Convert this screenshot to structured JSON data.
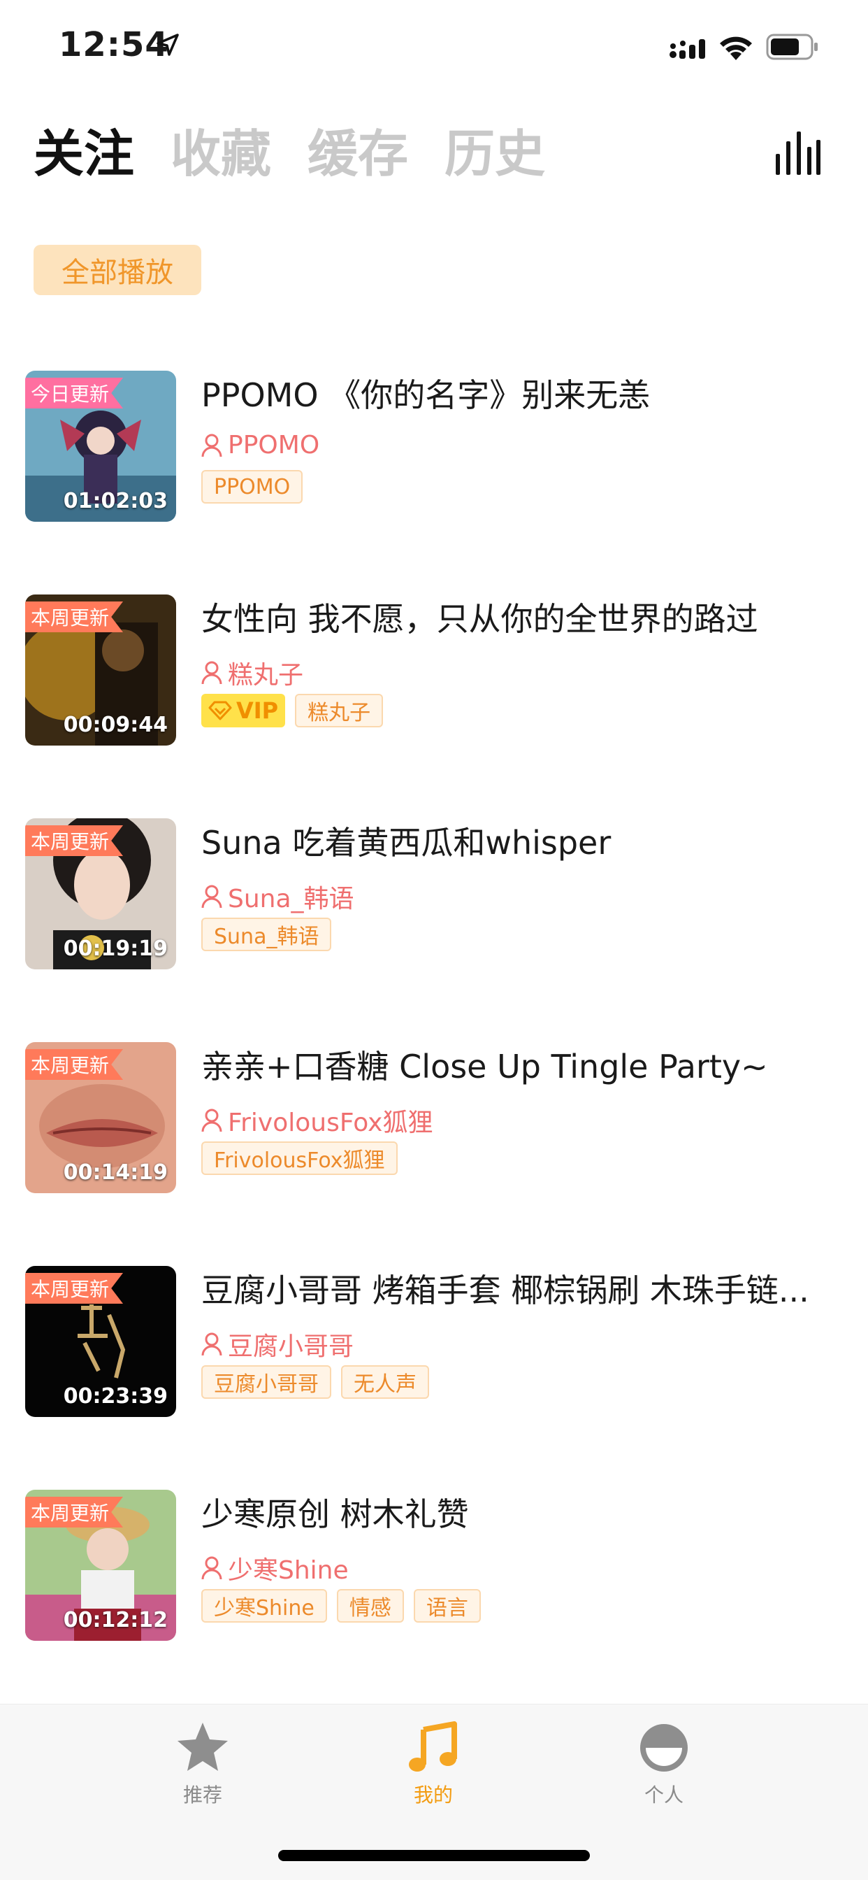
{
  "status_bar": {
    "time": "12:54"
  },
  "header": {
    "tabs": [
      {
        "label": "关注",
        "active": true
      },
      {
        "label": "收藏",
        "active": false
      },
      {
        "label": "缓存",
        "active": false
      },
      {
        "label": "历史",
        "active": false
      }
    ],
    "icon": "equalizer-icon"
  },
  "play_all_label": "全部播放",
  "items": [
    {
      "badge": "今日更新",
      "duration": "01:02:03",
      "title": "PPOMO 《你的名字》别来无恙",
      "author": "PPOMO",
      "tags": [
        "PPOMO"
      ],
      "vip": false
    },
    {
      "badge": "本周更新",
      "duration": "00:09:44",
      "title": "女性向 我不愿，只从你的全世界的路过",
      "author": "糕丸子",
      "tags": [
        "糕丸子"
      ],
      "vip": true,
      "vip_label": "VIP"
    },
    {
      "badge": "本周更新",
      "duration": "00:19:19",
      "title": "Suna 吃着黄西瓜和whisper",
      "author": "Suna_韩语",
      "tags": [
        "Suna_韩语"
      ],
      "vip": false
    },
    {
      "badge": "本周更新",
      "duration": "00:14:19",
      "title": "亲亲+口香糖 Close Up Tingle Party~",
      "author": "FrivolousFox狐狸",
      "tags": [
        "FrivolousFox狐狸"
      ],
      "vip": false
    },
    {
      "badge": "本周更新",
      "duration": "00:23:39",
      "title": "豆腐小哥哥 烤箱手套 椰棕锅刷 木珠手链...",
      "author": "豆腐小哥哥",
      "tags": [
        "豆腐小哥哥",
        "无人声"
      ],
      "vip": false
    },
    {
      "badge": "本周更新",
      "duration": "00:12:12",
      "title": "少寒原创 树木礼赞",
      "author": "少寒Shine",
      "tags": [
        "少寒Shine",
        "情感",
        "语言"
      ],
      "vip": false
    }
  ],
  "tabbar": {
    "items": [
      {
        "label": "推荐",
        "icon": "star-icon",
        "active": false
      },
      {
        "label": "我的",
        "icon": "music-note-icon",
        "active": true
      },
      {
        "label": "个人",
        "icon": "profile-icon",
        "active": false
      }
    ]
  },
  "colors": {
    "accent": "#f39c12",
    "author": "#ef6f6f",
    "tag_text": "#ec8a2b"
  }
}
